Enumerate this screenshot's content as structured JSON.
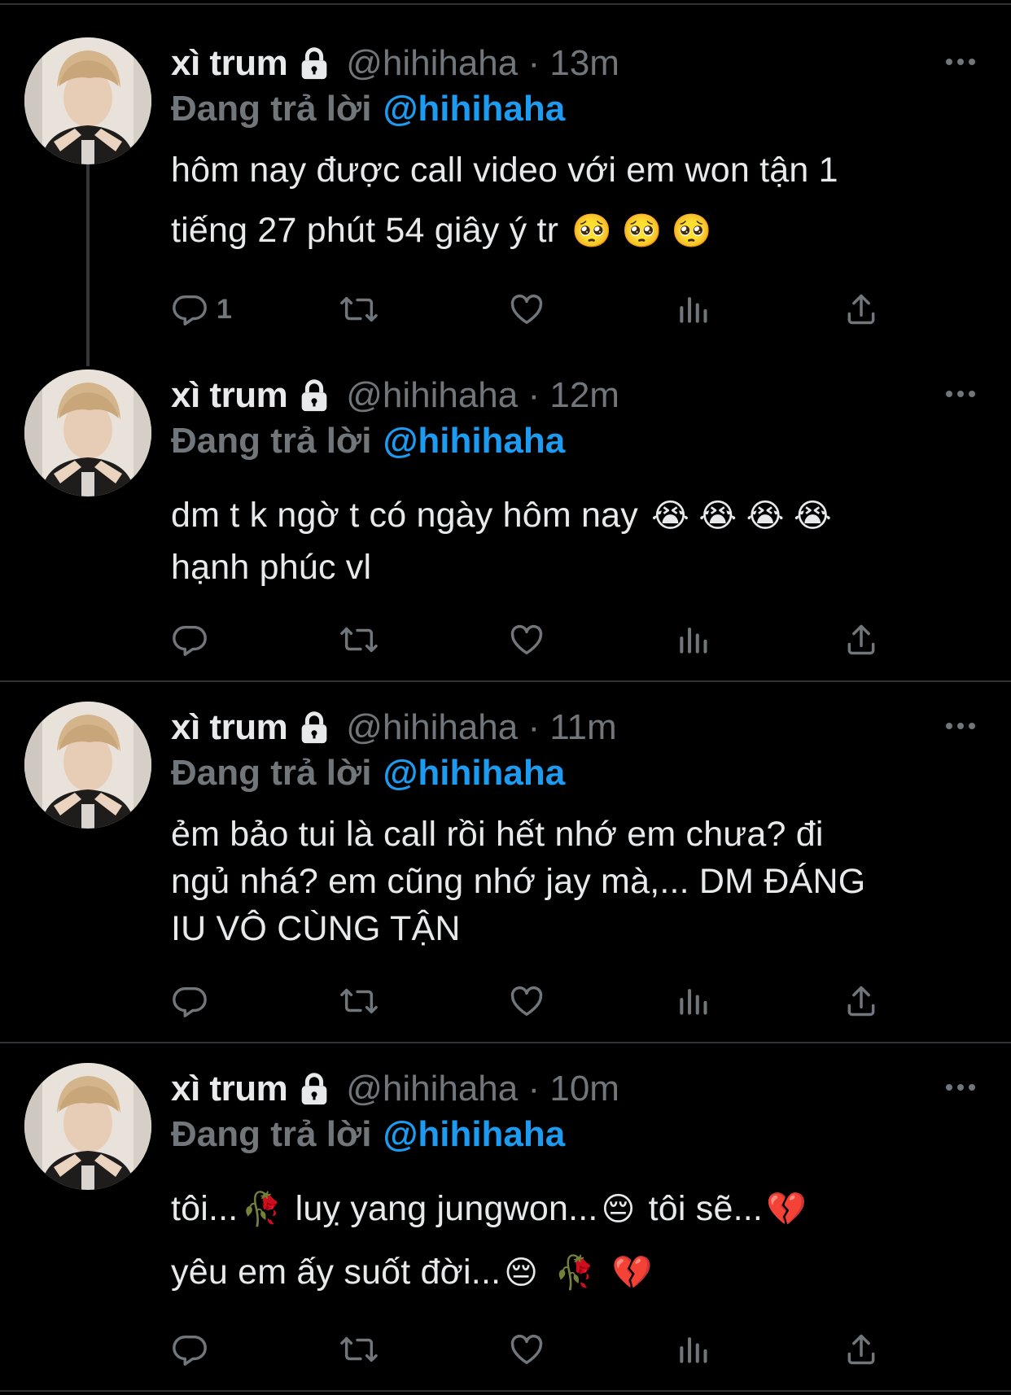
{
  "tweets": [
    {
      "name": "xì trum",
      "handle_time": "@hihihaha · 13m",
      "replying_label": "Đang trả lời",
      "replying_to": "@hihihaha",
      "lines": [
        "hôm nay được call video với em won tận 1",
        "tiếng 27 phút 54 giây ý tr"
      ],
      "line_emojis": [
        "",
        "🥺 🥺 🥺"
      ],
      "reply_count": "1"
    },
    {
      "name": "xì trum",
      "handle_time": "@hihihaha · 12m",
      "replying_label": "Đang trả lời",
      "replying_to": "@hihihaha",
      "lines": [
        "dm t k ngờ t có ngày hôm nay",
        "hạnh phúc vl"
      ],
      "line_emojis": [
        "😭 😭 😭 😭",
        ""
      ],
      "reply_count": ""
    },
    {
      "name": "xì trum",
      "handle_time": "@hihihaha · 11m",
      "replying_label": "Đang trả lời",
      "replying_to": "@hihihaha",
      "lines": [
        "ẻm bảo tui là call rồi hết nhớ em chưa? đi",
        "ngủ nhá? em cũng nhớ jay mà,... DM ĐÁNG",
        "IU VÔ CÙNG TẬN"
      ],
      "line_emojis": [
        "",
        "",
        ""
      ],
      "reply_count": ""
    },
    {
      "name": "xì trum",
      "handle_time": "@hihihaha · 10m",
      "replying_label": "Đang trả lời",
      "replying_to": "@hihihaha",
      "segments": [
        [
          "tôi...",
          "🥀",
          " luỵ yang jungwon...",
          "😔",
          "  tôi sẽ...",
          "💔"
        ],
        [
          "yêu em ấy suốt đời...",
          "😔",
          " ",
          "🥀",
          " ",
          "💔"
        ]
      ],
      "reply_count": ""
    }
  ],
  "icons": [
    "lock-icon",
    "more-icon",
    "reply-icon",
    "retweet-icon",
    "like-icon",
    "views-icon",
    "share-icon"
  ],
  "colors": {
    "background": "#000000",
    "text": "#e7e9ea",
    "muted": "#71767b",
    "link": "#1d9bf0",
    "divider": "#2f3336"
  }
}
